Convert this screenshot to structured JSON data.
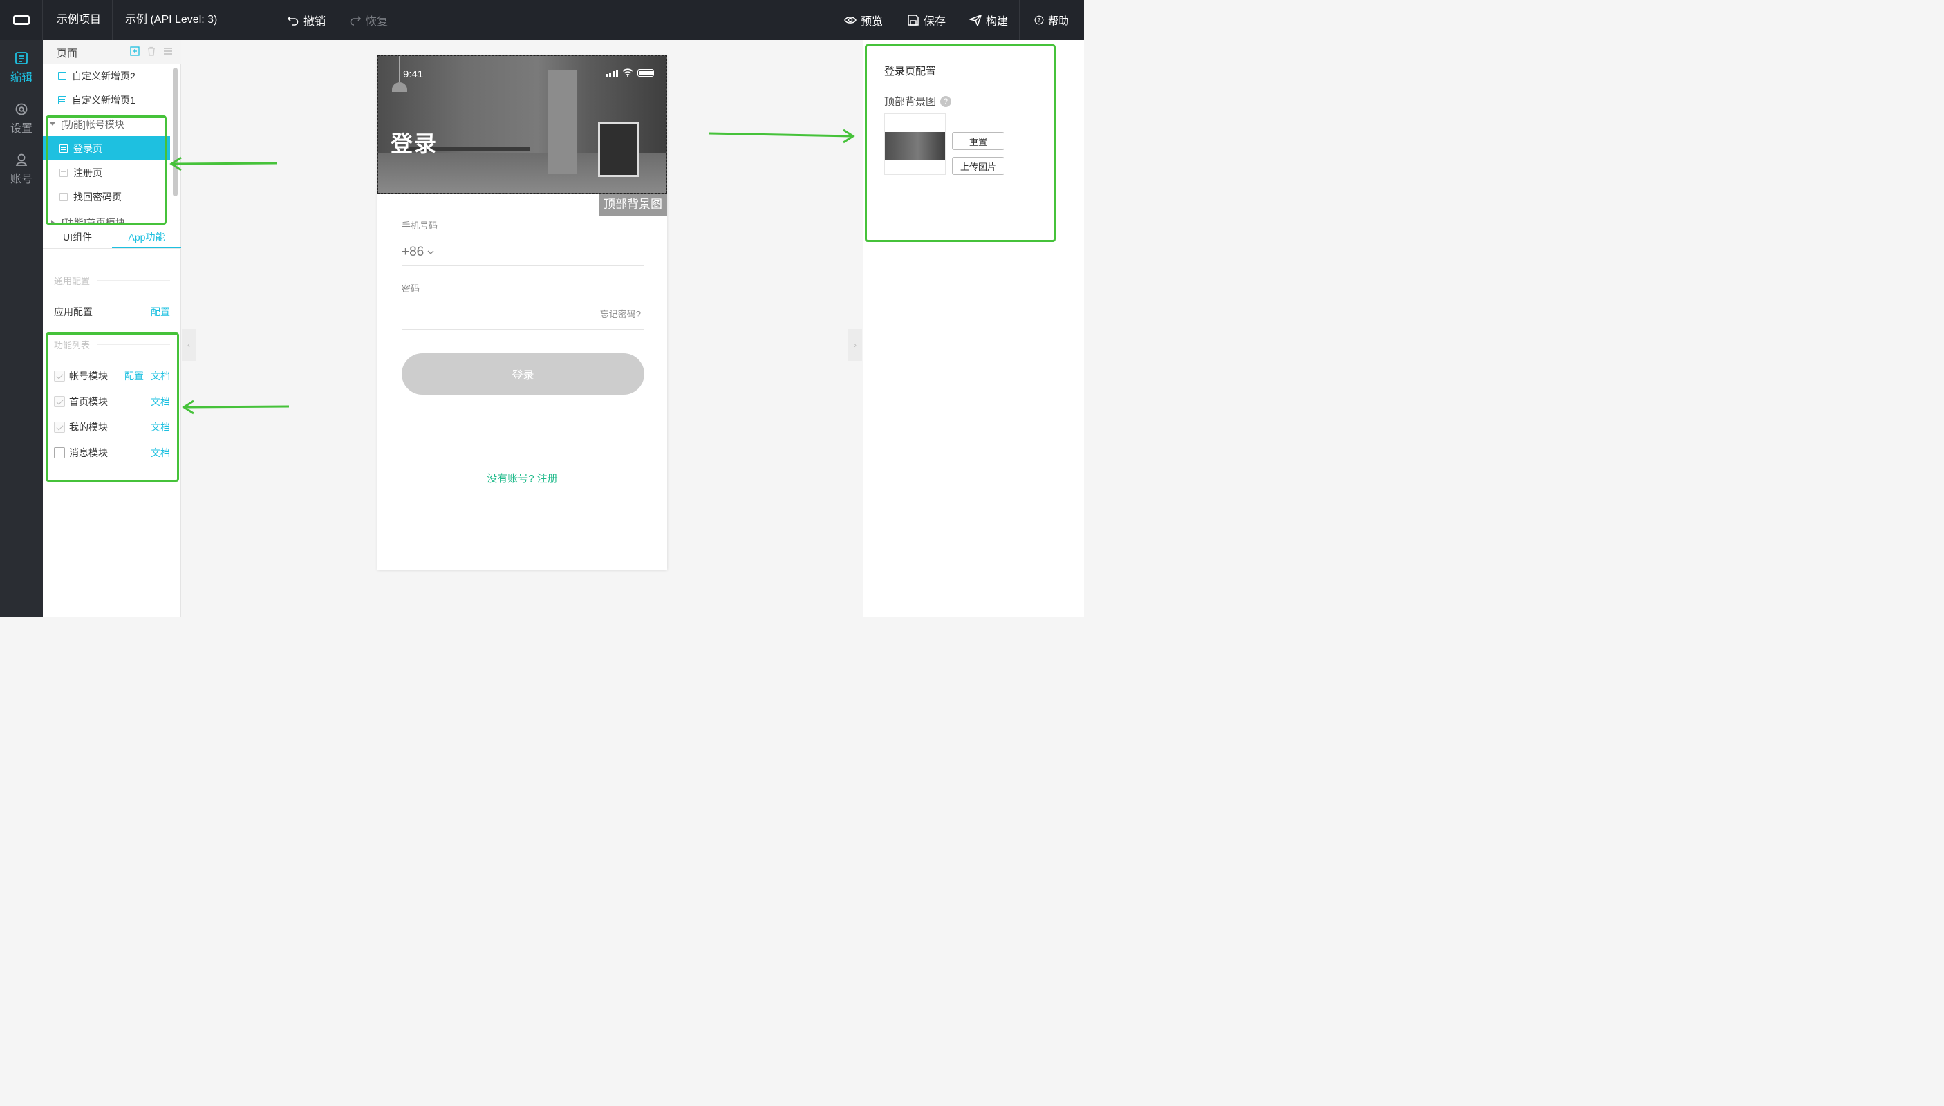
{
  "topbar": {
    "project": "示例项目",
    "app": "示例 (API Level: 3)",
    "undo": "撤销",
    "redo": "恢复",
    "preview": "预览",
    "save": "保存",
    "build": "构建",
    "help": "帮助"
  },
  "rail": {
    "items": [
      {
        "label": "编辑",
        "icon": "edit-icon"
      },
      {
        "label": "设置",
        "icon": "settings-icon"
      },
      {
        "label": "账号",
        "icon": "account-icon"
      }
    ]
  },
  "pages_panel": {
    "title": "页面",
    "items": [
      {
        "label": "自定义新增页2"
      },
      {
        "label": "自定义新增页1"
      },
      {
        "label": "[功能]帐号模块"
      },
      {
        "label": "登录页"
      },
      {
        "label": "注册页"
      },
      {
        "label": "找回密码页"
      },
      {
        "label": "[功能]首页模块"
      }
    ]
  },
  "tabs": [
    "UI组件",
    "App功能"
  ],
  "general": {
    "section": "通用配置",
    "app_config": "应用配置",
    "config_link": "配置"
  },
  "features": {
    "section": "功能列表",
    "config_link": "配置",
    "doc_link": "文档",
    "items": [
      {
        "label": "帐号模块",
        "checked": true
      },
      {
        "label": "首页模块",
        "checked": true
      },
      {
        "label": "我的模块",
        "checked": true
      },
      {
        "label": "消息模块",
        "checked": false
      }
    ]
  },
  "phone": {
    "time": "9:41",
    "title": "登录",
    "hero_tag": "顶部背景图",
    "phone_label": "手机号码",
    "country_code": "+86",
    "password_label": "密码",
    "forgot": "忘记密码?",
    "login_button": "登录",
    "register": "没有账号? 注册"
  },
  "right_panel": {
    "title": "登录页配置",
    "bg_label": "顶部背景图",
    "help": "?",
    "reset": "重置",
    "upload": "上传图片"
  },
  "colors": {
    "accent": "#1ec0e0",
    "annotation": "#46c23a",
    "topbar": "#22252b",
    "register_link": "#1fba8a"
  }
}
